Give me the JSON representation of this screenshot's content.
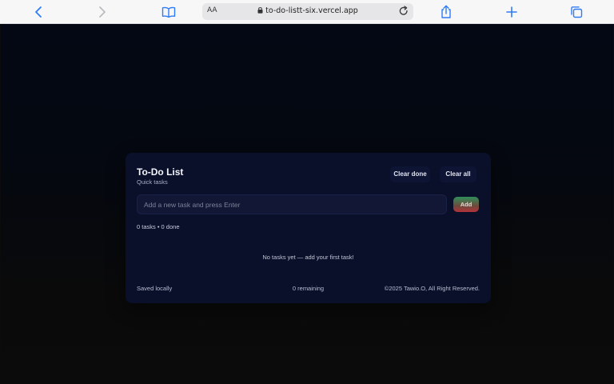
{
  "browser": {
    "text_size_label": "AA",
    "url": "to-do-listt-six.vercel.app",
    "icons": [
      "chevron-left-icon",
      "chevron-right-icon",
      "book-icon",
      "lock-icon",
      "reload-icon",
      "share-icon",
      "plus-icon",
      "tabs-icon"
    ],
    "accent_color": "#2f7cf6"
  },
  "app": {
    "title": "To-Do List",
    "subtitle": "Quick tasks",
    "clear_done_label": "Clear done",
    "clear_all_label": "Clear all",
    "input_placeholder": "Add a new task and press Enter",
    "input_value": "",
    "add_label": "Add",
    "stats": "0 tasks • 0 done",
    "empty_message": "No tasks yet — add your first task!",
    "tasks": [],
    "footer": {
      "saved": "Saved locally",
      "remaining": "0 remaining",
      "copyright": "©2025 Tawio.O, All Right Reserved."
    },
    "colors": {
      "card_background": "#0a0f2a",
      "add_gradient_top": "#2f8f5a",
      "add_gradient_bottom": "#b3323a"
    }
  }
}
